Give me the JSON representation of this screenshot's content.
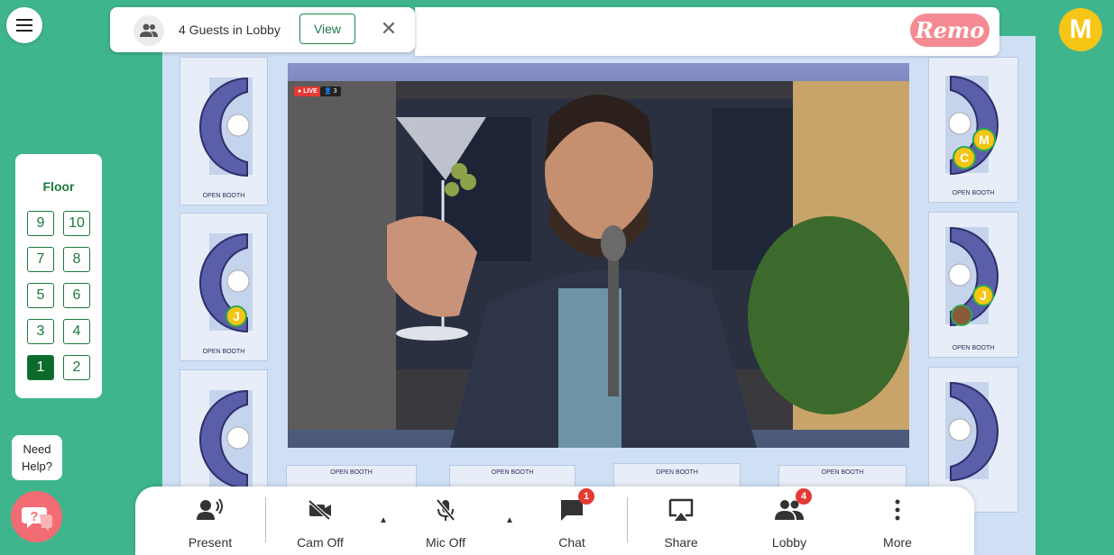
{
  "lobby": {
    "guest_text": "4 Guests in Lobby",
    "view_label": "View"
  },
  "brand": {
    "logo_text": "Remo",
    "logo_color": "#f58a93"
  },
  "user": {
    "avatar_initial": "M"
  },
  "floor_selector": {
    "title": "Floor",
    "floors": [
      "9",
      "10",
      "7",
      "8",
      "5",
      "6",
      "3",
      "4",
      "1",
      "2"
    ],
    "active_floor": "1"
  },
  "help": {
    "line1": "Need",
    "line2": "Help?"
  },
  "booths": {
    "label": "OPEN BOOTH"
  },
  "video": {
    "live_badge": "LIVE",
    "viewer_count": "3"
  },
  "seat_avatars": {
    "j": "J",
    "m": "M",
    "c": "C"
  },
  "toolbar": {
    "present": "Present",
    "cam": "Cam Off",
    "mic": "Mic Off",
    "chat": "Chat",
    "chat_badge": "1",
    "share": "Share",
    "lobby": "Lobby",
    "lobby_badge": "4",
    "more": "More"
  },
  "colors": {
    "background": "#3fb58d",
    "accent_green": "#1b7a3b",
    "badge_red": "#e53935"
  }
}
